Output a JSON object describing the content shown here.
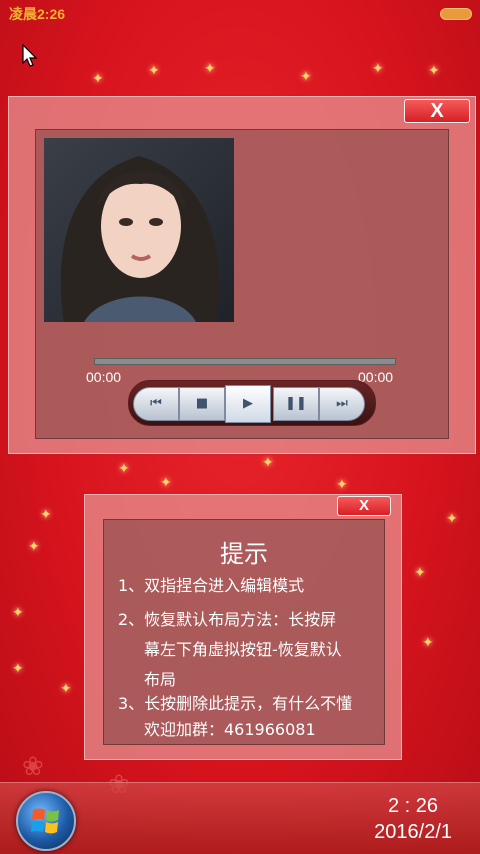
{
  "status_bar": {
    "time": "凌晨2:26"
  },
  "music_player": {
    "close_label": "X",
    "current_time": "00:00",
    "total_time": "00:00",
    "progress": 0,
    "controls": [
      "previous",
      "stop",
      "play",
      "pause",
      "next"
    ]
  },
  "tip_dialog": {
    "close_label": "X",
    "title": "提示",
    "lines": [
      "1、双指捏合进入编辑模式",
      "2、恢复默认布局方法：长按屏",
      "幕左下角虚拟按钮-恢复默认",
      "布局",
      "3、长按删除此提示，有什么不懂",
      "欢迎加群：461966081"
    ]
  },
  "taskbar": {
    "time": "2 : 26",
    "date": "2016/2/1"
  },
  "colors": {
    "background": "#d8141e",
    "status_time": "#f2b233",
    "close_button": "#d81f26"
  }
}
